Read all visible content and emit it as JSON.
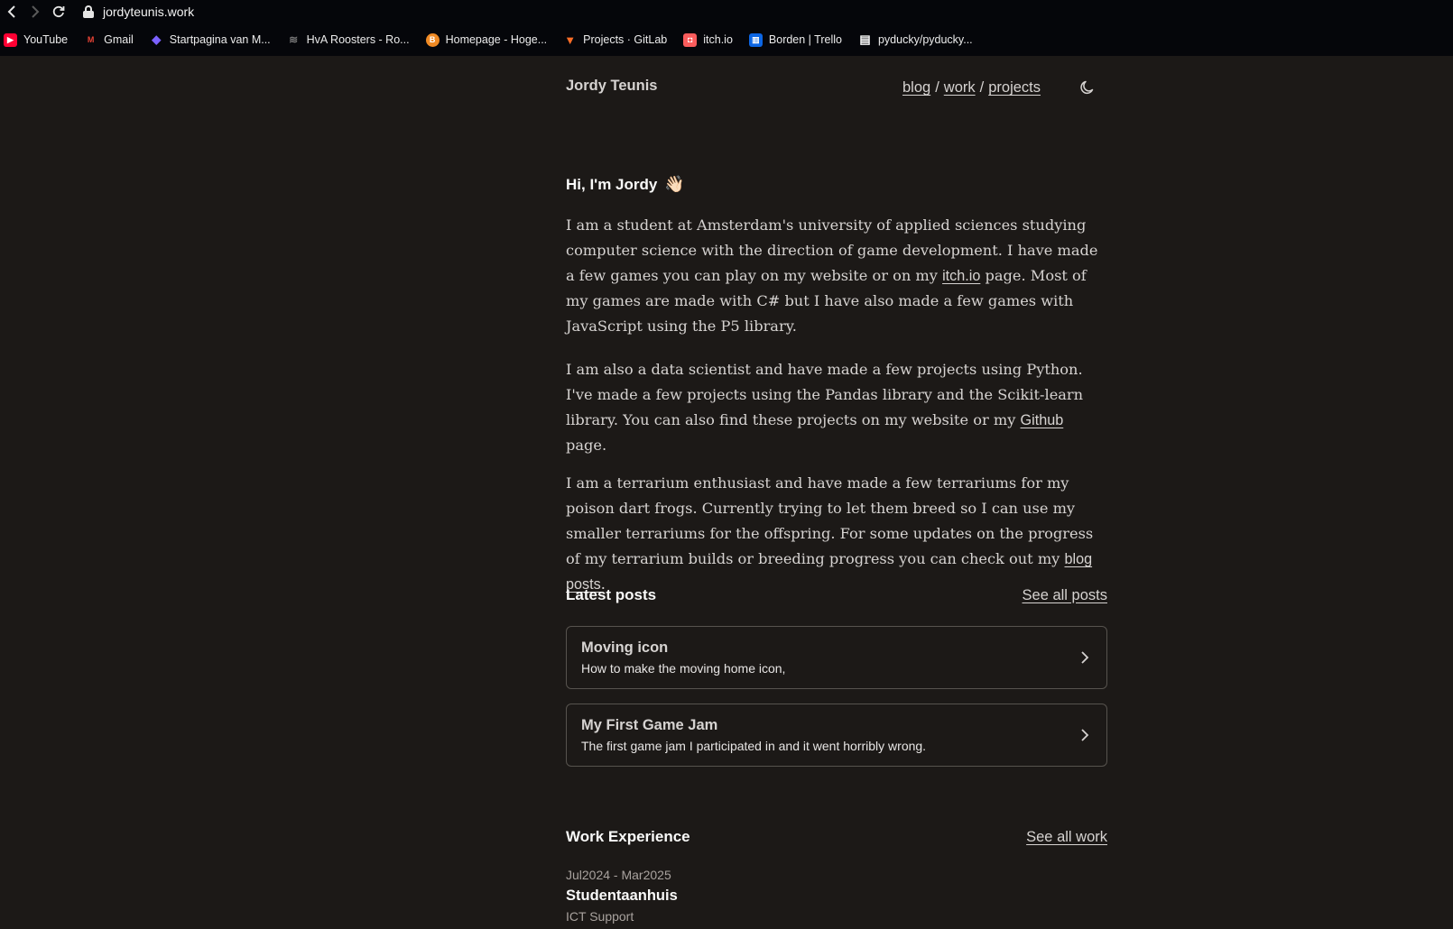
{
  "browser": {
    "url": "jordyteunis.work",
    "bookmarks": [
      {
        "label": "YouTube",
        "icon": "youtube-icon",
        "color": "#ff0033",
        "glyph": "▶"
      },
      {
        "label": "Gmail",
        "icon": "gmail-icon",
        "color": "#ea4335",
        "glyph": "M"
      },
      {
        "label": "Startpagina van M...",
        "icon": "microsoft-icon",
        "color": "#7b61ff",
        "glyph": "◆"
      },
      {
        "label": "HvA Roosters - Ro...",
        "icon": "wifi-icon",
        "color": "#05060a",
        "glyph": "≋"
      },
      {
        "label": "Homepage - Hoge...",
        "icon": "hva-icon",
        "color": "#f08a24",
        "glyph": "B"
      },
      {
        "label": "Projects · GitLab",
        "icon": "gitlab-icon",
        "color": "#fc6d26",
        "glyph": "▼"
      },
      {
        "label": "itch.io",
        "icon": "itchio-icon",
        "color": "#fa5c5c",
        "glyph": "◘"
      },
      {
        "label": "Borden | Trello",
        "icon": "trello-icon",
        "color": "#0c66e4",
        "glyph": "▥"
      },
      {
        "label": "pyducky/pyducky...",
        "icon": "file-icon",
        "color": "#05060a",
        "glyph": "▤"
      }
    ]
  },
  "site": {
    "title": "Jordy Teunis",
    "nav": {
      "blog": "blog",
      "work": "work",
      "projects": "projects",
      "sep": "/"
    }
  },
  "intro": {
    "greeting": "Hi, I'm Jordy",
    "wave": "👋🏻",
    "p1_a": "I am a student at Amsterdam's university of applied sciences studying computer science with the direction of game development. I have made a few games you can play on my website or on my ",
    "p1_link": "itch.io",
    "p1_b": " page. Most of my games are made with C# but I have also made a few games with JavaScript using the P5 library.",
    "p2_a": "I am also a data scientist and have made a few projects using Python. I've made a few projects using the Pandas library and the Scikit-learn library. You can also find these projects on my website or my ",
    "p2_link": "Github",
    "p2_b": " page.",
    "p3_a": "I am a terrarium enthusiast and have made a few terrariums for my poison dart frogs. Currently trying to let them breed so I can use my smaller terrariums for the offspring. For some updates on the progress of my terrarium builds or breeding progress you can check out my ",
    "p3_link": "blog posts",
    "p3_b": "."
  },
  "posts": {
    "heading": "Latest posts",
    "see_all": "See all posts",
    "items": [
      {
        "title": "Moving icon",
        "desc": "How to make the moving home icon,"
      },
      {
        "title": "My First Game Jam",
        "desc": "The first game jam I participated in and it went horribly wrong."
      }
    ]
  },
  "work": {
    "heading": "Work Experience",
    "see_all": "See all work",
    "items": [
      {
        "date": "Jul2024 - Mar2025",
        "company": "Studentaanhuis",
        "role": "ICT Support"
      }
    ]
  }
}
